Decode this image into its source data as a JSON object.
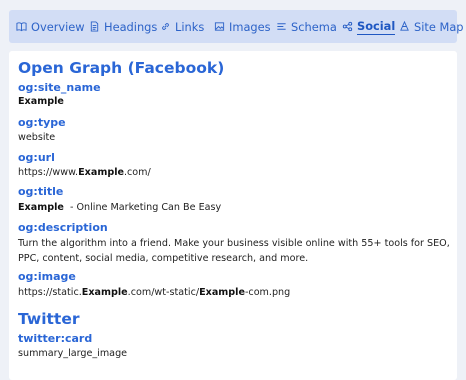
{
  "tabs": [
    {
      "label": "Overview",
      "icon": "book-icon"
    },
    {
      "label": "Headings",
      "icon": "document-icon"
    },
    {
      "label": "Links",
      "icon": "link-icon"
    },
    {
      "label": "Images",
      "icon": "image-icon"
    },
    {
      "label": "Schema",
      "icon": "list-icon"
    },
    {
      "label": "Social",
      "icon": "share-icon",
      "active": true
    },
    {
      "label": "Site Map",
      "icon": "sitemap-icon"
    }
  ],
  "colors": {
    "accent": "#2a66d6",
    "tabbar": "#d2ddf5",
    "background": "#eef1f7"
  },
  "open_graph": {
    "heading": "Open Graph (Facebook)",
    "site_name": {
      "key": "og:site_name",
      "value": "Example"
    },
    "type": {
      "key": "og:type",
      "value": "website"
    },
    "url": {
      "key": "og:url",
      "prefix": "https://www.",
      "brand": "Example",
      "suffix": ".com/"
    },
    "title": {
      "key": "og:title",
      "brand": "Example",
      "suffix": "  - Online Marketing Can Be Easy"
    },
    "description": {
      "key": "og:description",
      "value": "Turn the algorithm into a friend. Make your business visible online with 55+ tools for SEO, PPC, content, social media, competitive research, and more."
    },
    "image": {
      "key": "og:image",
      "prefix": "https://static.",
      "brand": "Example",
      "middle": ".com/wt-static/",
      "brand2": "Example",
      "suffix": "-com.png"
    }
  },
  "twitter": {
    "heading": "Twitter",
    "card": {
      "key": "twitter:card",
      "value": "summary_large_image"
    }
  }
}
